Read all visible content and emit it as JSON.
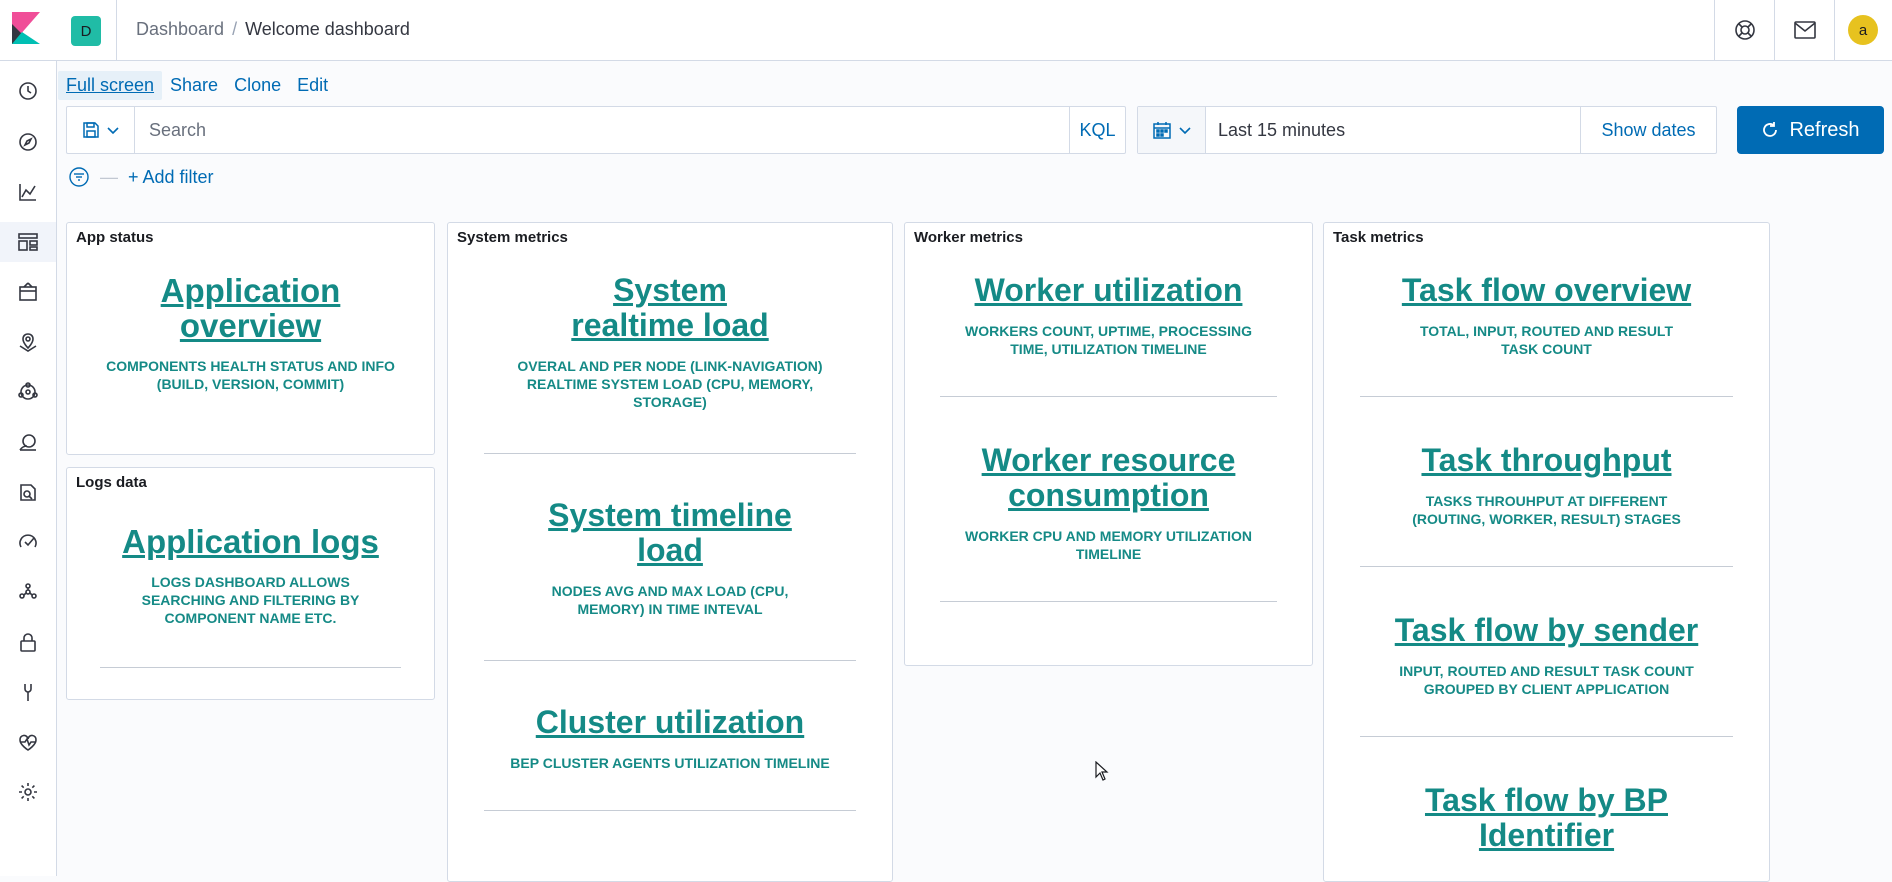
{
  "header": {
    "space_initial": "D",
    "breadcrumbs": [
      {
        "label": "Dashboard"
      },
      {
        "label": "Welcome dashboard"
      }
    ],
    "avatar_initial": "a",
    "icons": [
      "kibana-logo-icon",
      "help-icon",
      "newsfeed-mail-icon"
    ]
  },
  "sidenav": {
    "items": [
      {
        "name": "recently-viewed-icon"
      },
      {
        "name": "discover-icon"
      },
      {
        "name": "visualize-icon"
      },
      {
        "name": "dashboard-icon",
        "active": true
      },
      {
        "name": "canvas-icon"
      },
      {
        "name": "maps-icon"
      },
      {
        "name": "machine-learning-icon"
      },
      {
        "name": "infrastructure-icon"
      },
      {
        "name": "logs-icon"
      },
      {
        "name": "apm-icon"
      },
      {
        "name": "graph-icon"
      },
      {
        "name": "siem-lock-icon"
      },
      {
        "name": "dev-tools-icon"
      },
      {
        "name": "stack-monitoring-icon"
      },
      {
        "name": "management-gear-icon"
      }
    ]
  },
  "topnav": {
    "full_screen": "Full screen",
    "share": "Share",
    "clone": "Clone",
    "edit": "Edit"
  },
  "query": {
    "placeholder": "Search",
    "language": "KQL"
  },
  "datepicker": {
    "range": "Last 15 minutes",
    "show_dates": "Show dates"
  },
  "refresh_label": "Refresh",
  "filter": {
    "add_label": "+ Add filter"
  },
  "panels": {
    "app_status": {
      "title": "App status",
      "entries": [
        {
          "title": "Application overview",
          "desc": "COMPONENTS HEALTH STATUS AND INFO (BUILD, VERSION, COMMIT)"
        }
      ]
    },
    "logs_data": {
      "title": "Logs data",
      "entries": [
        {
          "title": "Application logs",
          "desc": "LOGS DASHBOARD ALLOWS SEARCHING AND FILTERING BY COMPONENT NAME ETC."
        }
      ]
    },
    "system_metrics": {
      "title": "System metrics",
      "entries": [
        {
          "title": "System realtime load",
          "desc": "OVERAL AND PER NODE (LINK-NAVIGATION) REALTIME SYSTEM LOAD (CPU, MEMORY, STORAGE)"
        },
        {
          "title": "System timeline load",
          "desc": "NODES AVG AND MAX LOAD (CPU, MEMORY) IN TIME INTEVAL"
        },
        {
          "title": "Cluster utilization",
          "desc": "BEP CLUSTER AGENTS UTILIZATION TIMELINE"
        }
      ]
    },
    "worker_metrics": {
      "title": "Worker metrics",
      "entries": [
        {
          "title": "Worker utilization",
          "desc": "WORKERS COUNT, UPTIME, PROCESSING TIME, UTILIZATION TIMELINE"
        },
        {
          "title": "Worker resource consumption",
          "desc": "WORKER CPU AND MEMORY UTILIZATION TIMELINE"
        }
      ]
    },
    "task_metrics": {
      "title": "Task metrics",
      "entries": [
        {
          "title": "Task flow overview",
          "desc": "TOTAL, INPUT, ROUTED AND RESULT TASK COUNT"
        },
        {
          "title": "Task throughput",
          "desc": "TASKS THROUHPUT AT DIFFERENT (ROUTING, WORKER, RESULT) STAGES"
        },
        {
          "title": "Task flow by sender",
          "desc": "INPUT, ROUTED AND RESULT TASK COUNT GROUPED BY CLIENT APPLICATION"
        },
        {
          "title": "Task flow by BP Identifier",
          "desc": ""
        }
      ]
    }
  },
  "colors": {
    "accent": "#006bb4",
    "link_teal": "#148a86",
    "space_badge": "#20bca6",
    "avatar": "#e7c21f"
  }
}
